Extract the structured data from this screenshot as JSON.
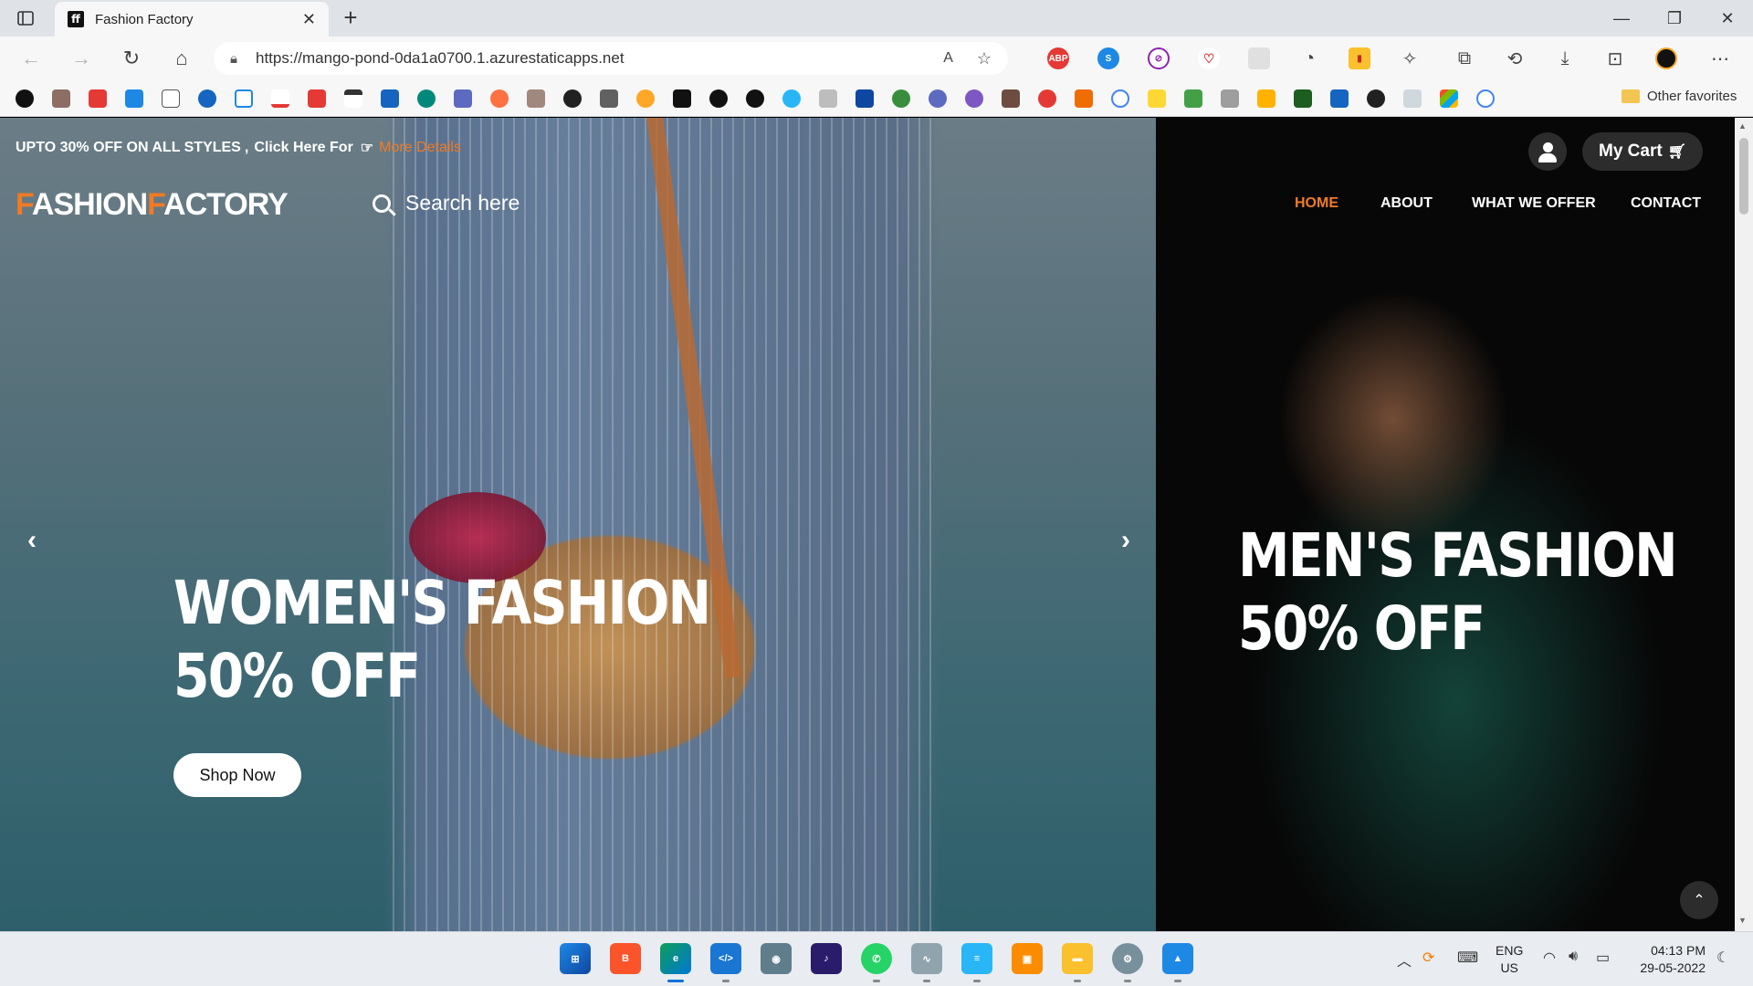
{
  "browser": {
    "tab_title": "Fashion Factory",
    "tab_favicon": "ff",
    "url": "https://mango-pond-0da1a0700.1.azurestaticapps.net",
    "other_favorites": "Other favorites"
  },
  "site": {
    "promo": {
      "text": "UPTO 30% OFF ON ALL STYLES",
      "separator": ",",
      "click_text": "Click Here For",
      "link_text": "More Details"
    },
    "logo": {
      "letter1": "F",
      "part1": "ASHION",
      "letter2": "F",
      "part2": "ACTORY"
    },
    "search_placeholder": "Search here",
    "cart_label": "My Cart",
    "nav": [
      "HOME",
      "ABOUT",
      "WHAT WE OFFER",
      "CONTACT"
    ],
    "women": {
      "line1": "WOMEN'S FASHION",
      "line2": "50% OFF",
      "button": "Shop Now"
    },
    "men": {
      "line1": "MEN'S FASHION",
      "line2": "50% OFF"
    }
  },
  "taskbar": {
    "lang_line1": "ENG",
    "lang_line2": "US",
    "time": "04:13 PM",
    "date": "29-05-2022"
  },
  "colors": {
    "accent": "#f07b24",
    "dark_button": "#2c2c2c"
  },
  "icons": {
    "search": "search-icon",
    "user": "user-icon",
    "cart": "cart-icon",
    "prev": "chevron-left-icon",
    "next": "chevron-right-icon",
    "to_top": "chevron-double-up-icon"
  }
}
